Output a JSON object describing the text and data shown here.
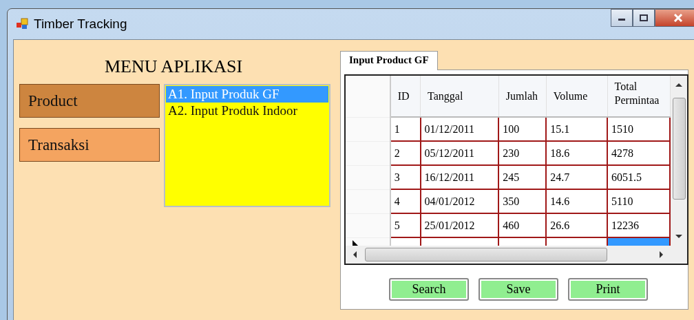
{
  "window": {
    "title": "Timber Tracking"
  },
  "menu": {
    "title": "MENU APLIKASI",
    "buttons": [
      {
        "label": "Product",
        "selected": true
      },
      {
        "label": "Transaksi",
        "selected": false
      }
    ]
  },
  "list": {
    "items": [
      {
        "label": "A1. Input Produk GF",
        "selected": true
      },
      {
        "label": "A2. Input Produk Indoor",
        "selected": false
      }
    ]
  },
  "tabs": [
    {
      "label": "Input Product GF",
      "selected": true
    }
  ],
  "table": {
    "columns": [
      "ID",
      "Tanggal",
      "Jumlah",
      "Volume",
      "Total Permintaa"
    ],
    "rows": [
      [
        "1",
        "01/12/2011",
        "100",
        "15.1",
        "1510"
      ],
      [
        "2",
        "05/12/2011",
        "230",
        "18.6",
        "4278"
      ],
      [
        "3",
        "16/12/2011",
        "245",
        "24.7",
        "6051.5"
      ],
      [
        "4",
        "04/01/2012",
        "350",
        "14.6",
        "5110"
      ],
      [
        "5",
        "25/01/2012",
        "460",
        "26.6",
        "12236"
      ]
    ],
    "new_row": {
      "current": true
    }
  },
  "buttons": [
    "Search",
    "Save",
    "Print"
  ]
}
